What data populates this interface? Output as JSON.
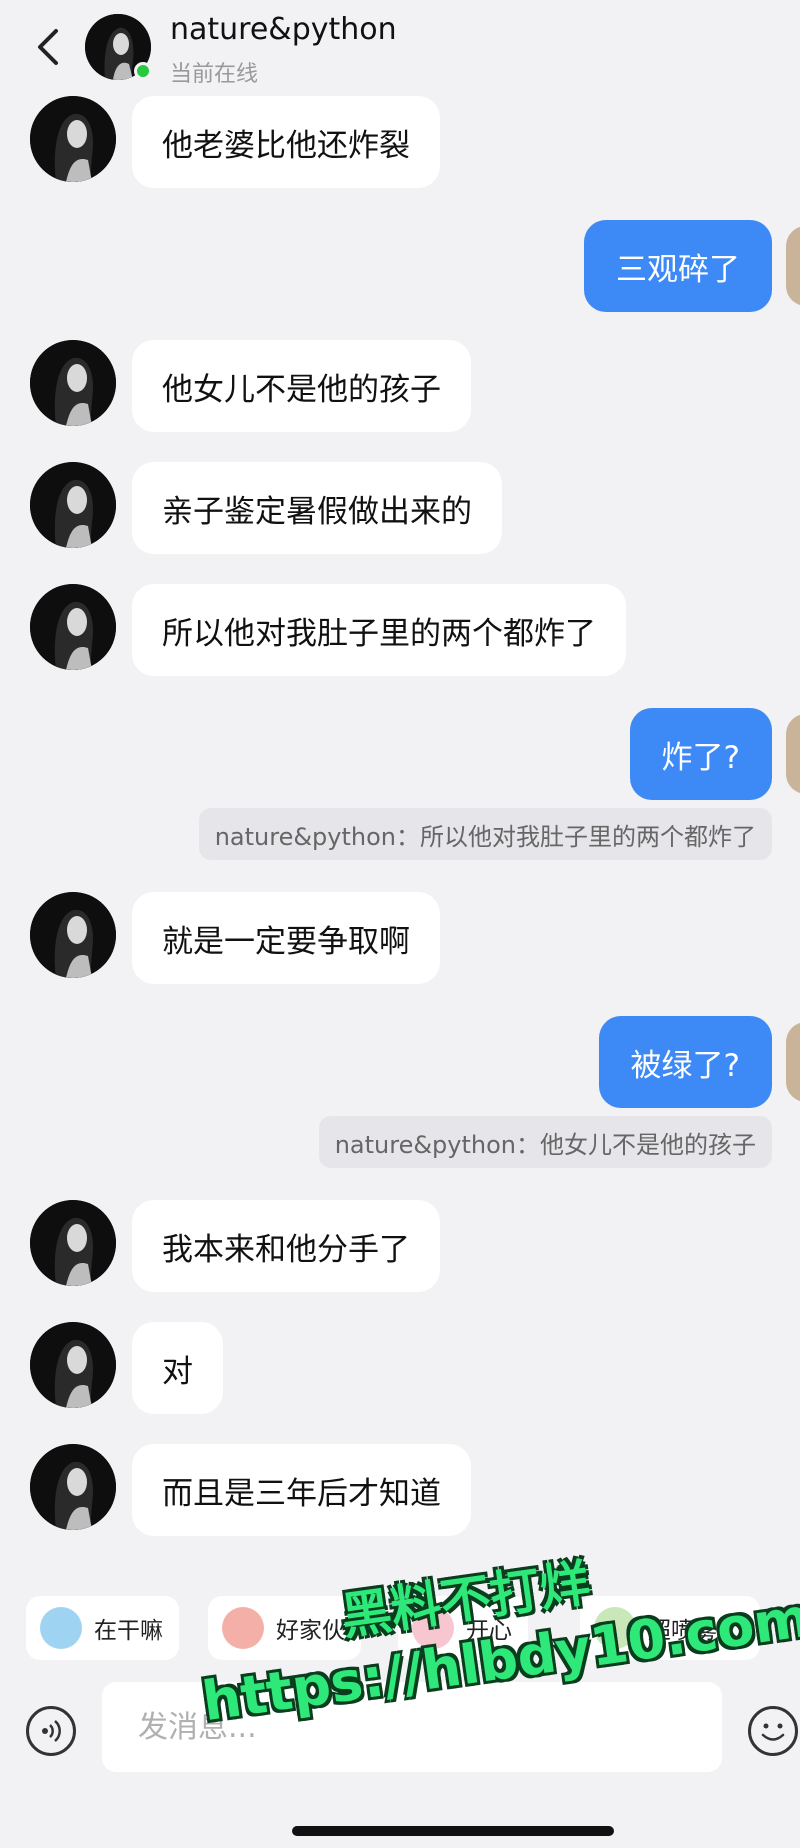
{
  "header": {
    "contact_name": "nature&python",
    "status": "当前在线"
  },
  "messages": [
    {
      "side": "in",
      "text": "他老婆比他还炸裂"
    },
    {
      "side": "out",
      "text": "三观碎了"
    },
    {
      "side": "in",
      "text": "他女儿不是他的孩子"
    },
    {
      "side": "in",
      "text": "亲子鉴定暑假做出来的"
    },
    {
      "side": "in",
      "text": "所以他对我肚子里的两个都炸了"
    },
    {
      "side": "out",
      "text": "炸了?",
      "quote": "nature&python：所以他对我肚子里的两个都炸了"
    },
    {
      "side": "in",
      "text": "就是一定要争取啊"
    },
    {
      "side": "out",
      "text": "被绿了?",
      "quote": "nature&python：他女儿不是他的孩子"
    },
    {
      "side": "in",
      "text": "我本来和他分手了"
    },
    {
      "side": "in",
      "text": "对"
    },
    {
      "side": "in",
      "text": "而且是三年后才知道"
    }
  ],
  "quick_replies": [
    {
      "label": "在干嘛"
    },
    {
      "label": "好家伙"
    },
    {
      "label": "开心"
    },
    {
      "label": "超喷雾"
    }
  ],
  "input": {
    "placeholder": "发消息..."
  },
  "watermark": {
    "line1": "黑料不打烊",
    "line2": "https://hlbdy10.com"
  },
  "colors": {
    "outgoing_bubble": "#3d8af7",
    "incoming_bubble": "#ffffff",
    "background": "#f2f2f5",
    "online_dot": "#27c93f",
    "watermark": "#2ee87a"
  }
}
